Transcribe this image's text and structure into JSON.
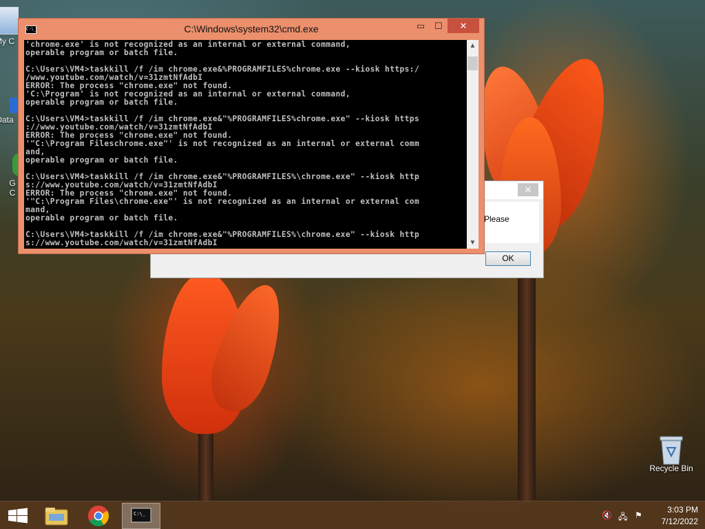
{
  "desktop": {
    "icons": [
      {
        "label": "My C"
      },
      {
        "label": "Data"
      },
      {
        "label": "G"
      },
      {
        "label": "C"
      },
      {
        "label": "Recycle Bin"
      }
    ]
  },
  "dialog": {
    "text": "Please",
    "ok_label": "OK",
    "close_glyph": "✕"
  },
  "cmd": {
    "title": "C:\\Windows\\system32\\cmd.exe",
    "icon_text": "C:\\_",
    "minimize_glyph": "▭",
    "maximize_glyph": "☐",
    "close_glyph": "✕",
    "console_text": "'chrome.exe' is not recognized as an internal or external command,\noperable program or batch file.\n\nC:\\Users\\VM4>taskkill /f /im chrome.exe&%PROGRAMFILES%chrome.exe --kiosk https:/\n/www.youtube.com/watch/v=31zmtNfAdbI\nERROR: The process \"chrome.exe\" not found.\n'C:\\Program' is not recognized as an internal or external command,\noperable program or batch file.\n\nC:\\Users\\VM4>taskkill /f /im chrome.exe&\"%PROGRAMFILES%chrome.exe\" --kiosk https\n://www.youtube.com/watch/v=31zmtNfAdbI\nERROR: The process \"chrome.exe\" not found.\n'\"C:\\Program Fileschrome.exe\"' is not recognized as an internal or external comm\nand,\noperable program or batch file.\n\nC:\\Users\\VM4>taskkill /f /im chrome.exe&\"%PROGRAMFILES%\\chrome.exe\" --kiosk http\ns://www.youtube.com/watch/v=31zmtNfAdbI\nERROR: The process \"chrome.exe\" not found.\n'\"C:\\Program Files\\chrome.exe\"' is not recognized as an internal or external com\nmand,\noperable program or batch file.\n\nC:\\Users\\VM4>taskkill /f /im chrome.exe&\"%PROGRAMFILES%\\chrome.exe\" --kiosk http\ns://www.youtube.com/watch/v=31zmtNfAdbI",
    "scroll_up_glyph": "▲",
    "scroll_down_glyph": "▼"
  },
  "taskbar": {
    "apps": [
      {
        "icon": "start-icon"
      },
      {
        "icon": "file-explorer-icon"
      },
      {
        "icon": "chrome-icon"
      },
      {
        "icon": "cmd-icon",
        "active": true
      }
    ],
    "tray": {
      "volume_glyph": "🔇",
      "network_glyph": "🖧",
      "flag_glyph": "⚑"
    },
    "time": "3:03 PM",
    "date": "7/12/2022"
  },
  "colors": {
    "cmd_frame": "#ec8f6c",
    "cmd_close": "#c7503f",
    "taskbar": "#5a3a1e"
  }
}
